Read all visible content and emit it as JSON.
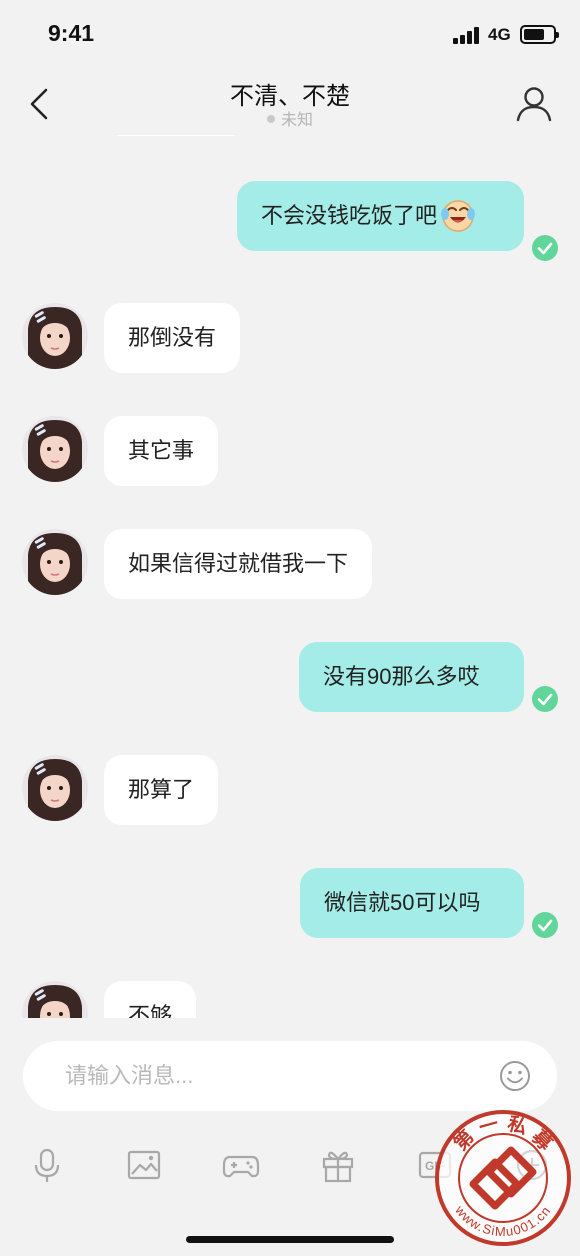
{
  "status_bar": {
    "time": "9:41",
    "network": "4G"
  },
  "header": {
    "title": "不清、不楚",
    "status": "未知"
  },
  "messages": [
    {
      "side": "out",
      "text": "不会没钱吃饭了吧",
      "emoji": "laughing-crying-face-icon",
      "read": true
    },
    {
      "side": "in",
      "text": "那倒没有"
    },
    {
      "side": "in",
      "text": "其它事"
    },
    {
      "side": "in",
      "text": "如果信得过就借我一下"
    },
    {
      "side": "out",
      "text": "没有90那么多哎",
      "read": true
    },
    {
      "side": "in",
      "text": "那算了"
    },
    {
      "side": "out",
      "text": "微信就50可以吗",
      "read": true
    },
    {
      "side": "in",
      "text": "不够"
    }
  ],
  "input": {
    "placeholder": "请输入消息..."
  },
  "toolbar": [
    "microphone-icon",
    "image-icon",
    "gamepad-icon",
    "gift-icon",
    "gif-icon",
    "plus-icon"
  ],
  "watermark": {
    "top_text": "第 一 私 募",
    "bottom_text": "www.SiMu001.cn",
    "color": "#c0392b"
  },
  "colors": {
    "outgoing_bubble": "#a4ece7",
    "incoming_bubble": "#ffffff",
    "read_check": "#62d69a",
    "background": "#f2f2f2"
  }
}
